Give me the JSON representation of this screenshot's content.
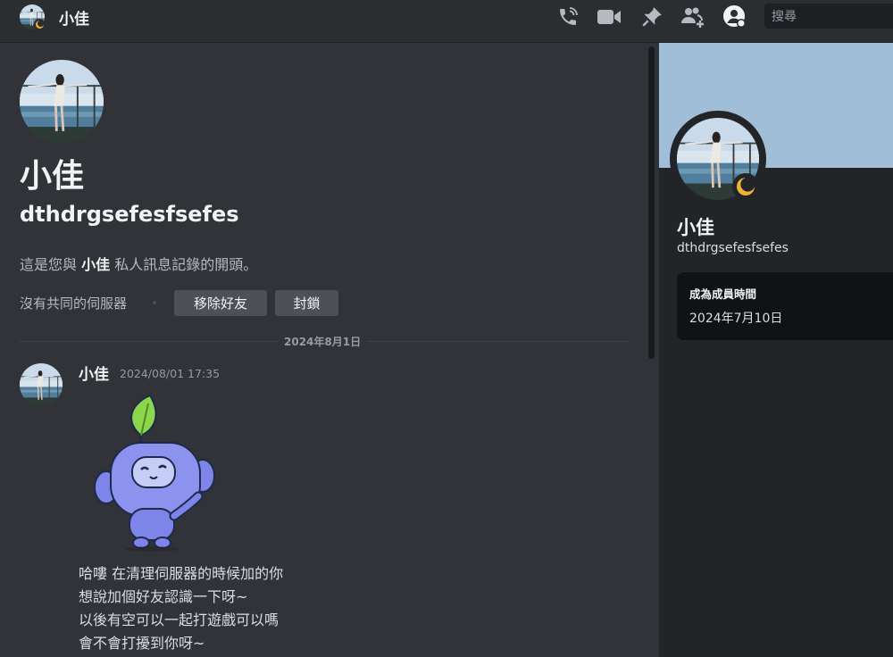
{
  "header": {
    "name": "小佳",
    "search_placeholder": "搜尋"
  },
  "intro": {
    "display_name": "小佳",
    "username": "dthdrgsefesfsefes",
    "beginning_prefix": "這是您與 ",
    "beginning_name": "小佳",
    "beginning_suffix": " 私人訊息記錄的開頭。",
    "no_mutual_servers": "沒有共同的伺服器",
    "remove_friend_label": "移除好友",
    "block_label": "封鎖"
  },
  "divider": {
    "date": "2024年8月1日"
  },
  "message": {
    "author": "小佳",
    "timestamp": "2024/08/01 17:35",
    "lines": [
      "哈嘍 在清理伺服器的時候加的你",
      "想說加個好友認識一下呀~",
      "以後有空可以一起打遊戲可以嗎",
      "會不會打擾到你呀~"
    ]
  },
  "profile": {
    "display_name": "小佳",
    "username": "dthdrgsefesfsefes",
    "member_since_title": "成為成員時間",
    "member_since_date": "2024年7月10日"
  },
  "colors": {
    "background": "#313338",
    "header": "#2b2d31",
    "panel": "#232428",
    "banner": "#a0bed7",
    "idle": "#f0b232",
    "button": "#4e5058",
    "sticker_blue": "#7d86e8",
    "leaf_green": "#8bd64b"
  },
  "icons": [
    "phone-call-icon",
    "video-call-icon",
    "pin-icon",
    "add-friend-icon",
    "profile-toggle-icon",
    "idle-moon-icon"
  ]
}
